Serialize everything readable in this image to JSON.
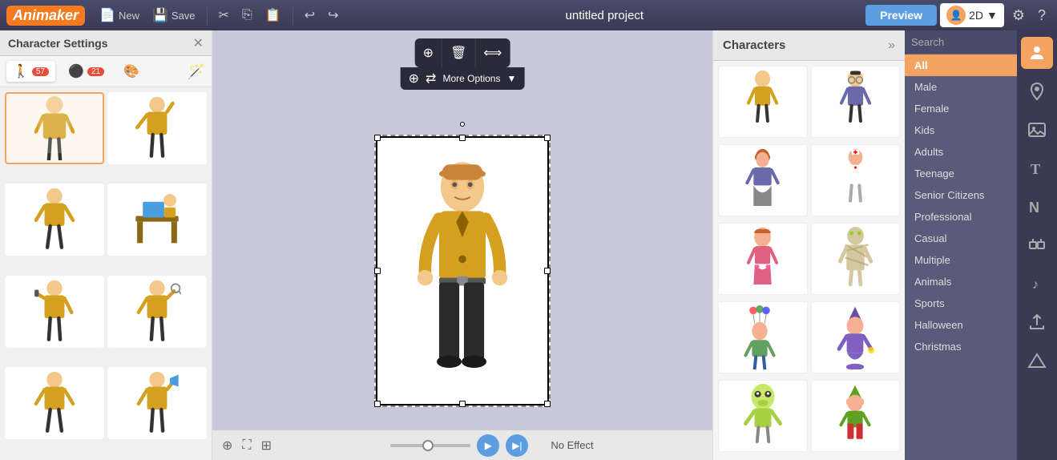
{
  "topbar": {
    "logo": "Animaker",
    "new_label": "New",
    "save_label": "Save",
    "project_title": "untitled project",
    "preview_label": "Preview",
    "mode_label": "2D",
    "undo_icon": "↩",
    "redo_icon": "↪",
    "cut_icon": "✂",
    "copy_icon": "⎘",
    "paste_icon": "📋"
  },
  "left_panel": {
    "title": "Character Settings",
    "tab_poses_count": "57",
    "tab_objects_count": "21",
    "tabs": [
      {
        "id": "poses",
        "icon": "🚶",
        "count": "57"
      },
      {
        "id": "objects",
        "icon": "⚫",
        "count": "21"
      },
      {
        "id": "colors",
        "icon": "🎨",
        "count": ""
      },
      {
        "id": "magic",
        "icon": "🪄",
        "count": ""
      }
    ]
  },
  "canvas": {
    "more_options_label": "More Options",
    "no_effect_label": "No Effect"
  },
  "characters_panel": {
    "title": "Characters",
    "search_placeholder": "Search"
  },
  "filter_panel": {
    "filters": [
      {
        "id": "all",
        "label": "All",
        "active": true
      },
      {
        "id": "male",
        "label": "Male",
        "active": false
      },
      {
        "id": "female",
        "label": "Female",
        "active": false
      },
      {
        "id": "kids",
        "label": "Kids",
        "active": false
      },
      {
        "id": "adults",
        "label": "Adults",
        "active": false
      },
      {
        "id": "teenage",
        "label": "Teenage",
        "active": false
      },
      {
        "id": "senior",
        "label": "Senior Citizens",
        "active": false
      },
      {
        "id": "professional",
        "label": "Professional",
        "active": false
      },
      {
        "id": "casual",
        "label": "Casual",
        "active": false
      },
      {
        "id": "multiple",
        "label": "Multiple",
        "active": false
      },
      {
        "id": "animals",
        "label": "Animals",
        "active": false
      },
      {
        "id": "sports",
        "label": "Sports",
        "active": false
      },
      {
        "id": "halloween",
        "label": "Halloween",
        "active": false
      },
      {
        "id": "christmas",
        "label": "Christmas",
        "active": false
      }
    ]
  }
}
